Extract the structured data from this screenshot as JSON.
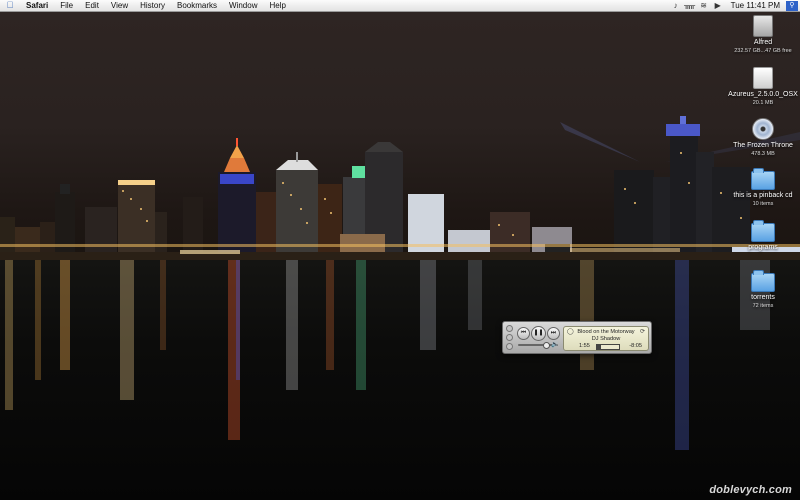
{
  "menubar": {
    "apple_icon": "apple-icon",
    "items": [
      "Safari",
      "File",
      "Edit",
      "View",
      "History",
      "Bookmarks",
      "Window",
      "Help"
    ],
    "status_icons": [
      "volume-icon",
      "bluetooth-icon",
      "wifi-icon",
      "speaker-icon"
    ],
    "clock": "Tue 11:41 PM",
    "spotlight_icon": "spotlight-icon"
  },
  "desktop": {
    "icons": [
      {
        "name": "Alfred",
        "sub": "232.57 GB...47 GB free",
        "icon": "hard-drive-icon"
      },
      {
        "name": "Azureus_2.5.0.0_OSX",
        "sub": "20.1 MB",
        "icon": "disk-image-icon"
      },
      {
        "name": "The Frozen Throne",
        "sub": "478.3 MB",
        "icon": "cd-icon"
      },
      {
        "name": "this is a pinback cd",
        "sub": "10 items",
        "icon": "folder-icon"
      },
      {
        "name": "programs",
        "sub": "",
        "icon": "folder-icon"
      },
      {
        "name": "torrents",
        "sub": "72 items",
        "icon": "folder-icon"
      }
    ],
    "watermark": "doblevych.com"
  },
  "itunes": {
    "track": "Blood on the Motorway",
    "artist": "DJ Shadow",
    "elapsed": "1:55",
    "remaining": "-8:05",
    "progress": 0.19,
    "volume": 0.8
  }
}
